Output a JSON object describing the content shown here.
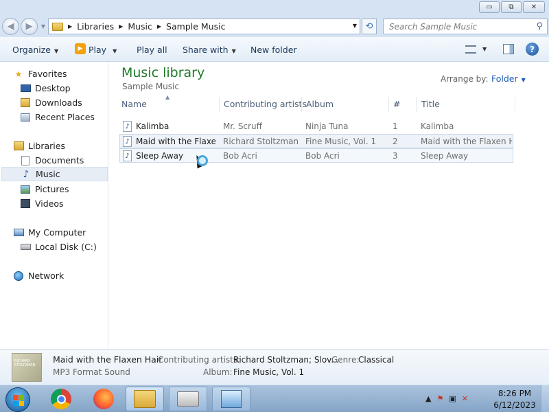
{
  "window": {
    "buttons": {
      "minimize": "▭",
      "maximize": "⧉",
      "close": "✕"
    }
  },
  "nav": {
    "back_glyph": "◀",
    "forward_glyph": "▶",
    "breadcrumbs": [
      "Libraries",
      "Music",
      "Sample Music"
    ],
    "search_placeholder": "Search Sample Music"
  },
  "toolbar": {
    "organize": "Organize",
    "play": "Play",
    "play_all": "Play all",
    "share_with": "Share with",
    "new_folder": "New folder"
  },
  "sidebar": {
    "favorites": "Favorites",
    "desktop": "Desktop",
    "downloads": "Downloads",
    "recent_places": "Recent Places",
    "libraries": "Libraries",
    "documents": "Documents",
    "music": "Music",
    "pictures": "Pictures",
    "videos": "Videos",
    "my_computer": "My Computer",
    "local_disk": "Local Disk (C:)",
    "network": "Network"
  },
  "main": {
    "title": "Music library",
    "subtitle": "Sample Music",
    "arrange_by_label": "Arrange by:",
    "arrange_by_value": "Folder",
    "columns": [
      "Name",
      "Contributing artists",
      "Album",
      "#",
      "Title"
    ],
    "rows": [
      {
        "name": "Kalimba",
        "artist": "Mr. Scruff",
        "album": "Ninja Tuna",
        "num": "1",
        "title": "Kalimba"
      },
      {
        "name": "Maid with the Flaxe...",
        "artist": "Richard Stoltzman...",
        "album": "Fine Music, Vol. 1",
        "num": "2",
        "title": "Maid with the Flaxen H..."
      },
      {
        "name": "Sleep Away",
        "artist": "Bob Acri",
        "album": "Bob Acri",
        "num": "3",
        "title": "Sleep Away"
      }
    ]
  },
  "details": {
    "file_name": "Maid with the Flaxen Hair",
    "file_type": "MP3 Format Sound",
    "artists_label": "Contributing artists:",
    "artists_value": "Richard Stoltzman; Slov...",
    "genre_label": "Genre:",
    "genre_value": "Classical",
    "album_label": "Album:",
    "album_value": "Fine Music, Vol. 1",
    "thumb_text": "RICHARD STOLTZMAN"
  },
  "taskbar": {
    "time": "8:26 PM",
    "date": "6/12/2023",
    "tray_arrow": "▲"
  },
  "colors": {
    "accent": "#1e7a28",
    "link": "#1c5bb6",
    "taskbar": "#84a4c6"
  }
}
